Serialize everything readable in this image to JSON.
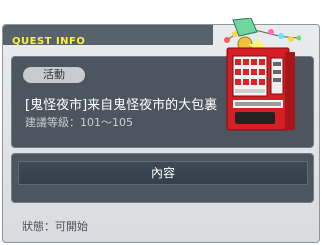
{
  "window": {
    "quest_id": "500839-0",
    "title": "QUEST INFO"
  },
  "quest": {
    "category": "活動",
    "name": "[鬼怪夜市]来自鬼怪夜市的大包裏",
    "level": "建議等級：101～105",
    "icon": "vending-machine-icon"
  },
  "content_button": {
    "label": "內容"
  },
  "status": {
    "text": "狀態：可開始"
  },
  "colors": {
    "title": "#ffee44",
    "panel": "#4d565e",
    "machine_red": "#d51f25"
  }
}
